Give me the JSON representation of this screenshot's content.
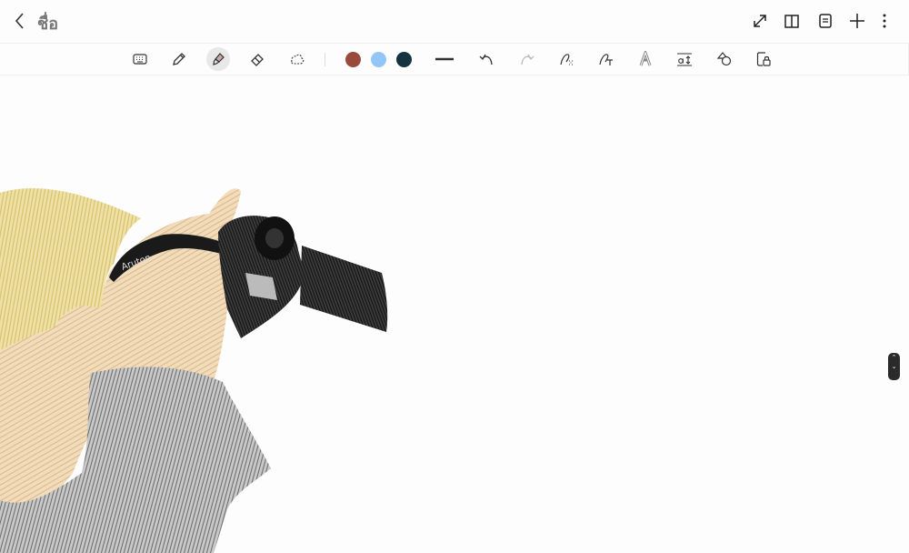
{
  "header": {
    "title": "ชื่อ",
    "icons": [
      "back-icon",
      "expand-icon",
      "book-view-icon",
      "page-list-icon",
      "add-icon",
      "more-icon"
    ]
  },
  "toolbar": {
    "tools": [
      "keyboard",
      "pen",
      "highlighter",
      "eraser",
      "lasso",
      "line-width",
      "undo",
      "redo",
      "pen-to-shape",
      "handwriting-to-text",
      "ink-style",
      "text-spacing",
      "shapes",
      "read-only-lock"
    ],
    "active_tool": "highlighter",
    "colors": [
      "#9a4a3c",
      "#93c6f7",
      "#14323f"
    ]
  },
  "canvas": {
    "drawing_text": "Aruton"
  }
}
